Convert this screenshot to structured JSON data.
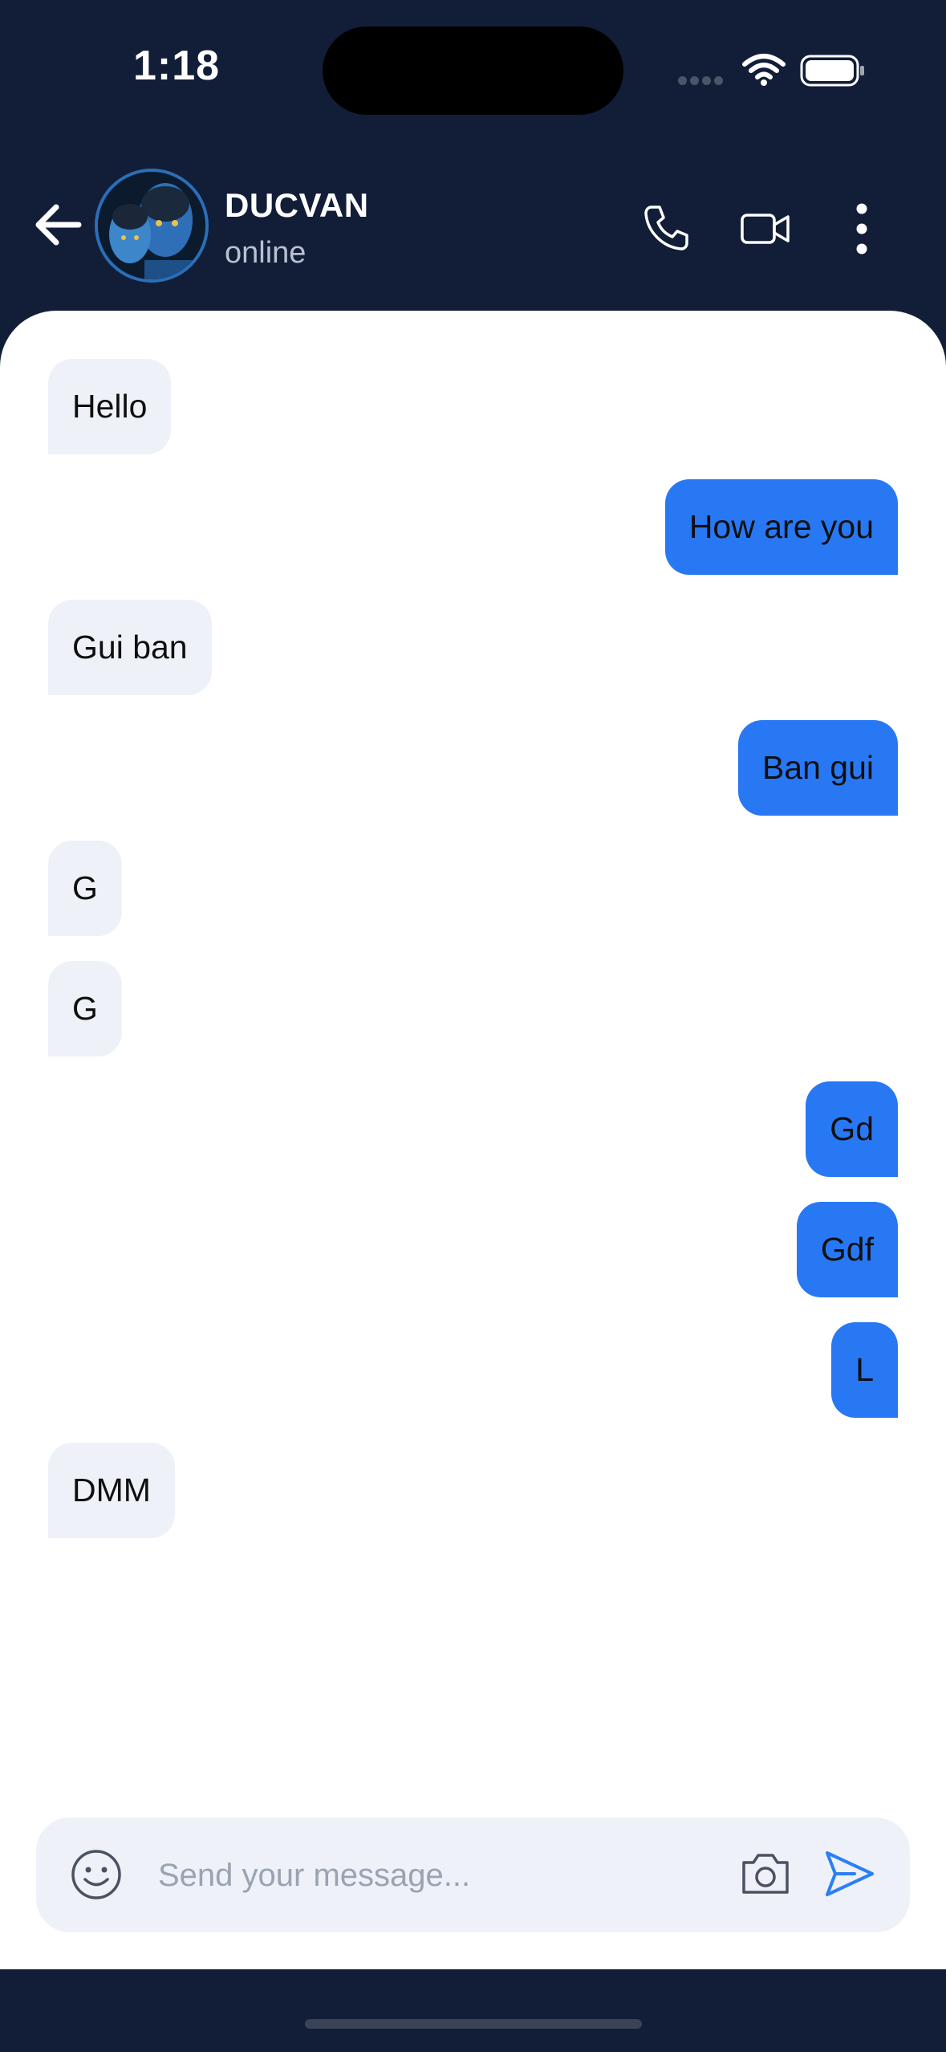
{
  "status_bar": {
    "time": "1:18"
  },
  "header": {
    "contact_name": "DUCVAN",
    "contact_status": "online"
  },
  "messages": [
    {
      "direction": "received",
      "text": "Hello"
    },
    {
      "direction": "sent",
      "text": "How are you"
    },
    {
      "direction": "received",
      "text": "Gui ban"
    },
    {
      "direction": "sent",
      "text": "Ban gui"
    },
    {
      "direction": "received",
      "text": "G"
    },
    {
      "direction": "received",
      "text": "G"
    },
    {
      "direction": "sent",
      "text": "Gd"
    },
    {
      "direction": "sent",
      "text": "Gdf"
    },
    {
      "direction": "sent",
      "text": "L"
    },
    {
      "direction": "received",
      "text": "DMM"
    }
  ],
  "composer": {
    "placeholder": "Send your message...",
    "value": ""
  },
  "icons": {
    "back": "arrow-left-icon",
    "call": "phone-icon",
    "video": "video-camera-icon",
    "more": "more-vertical-icon",
    "emoji": "smiley-icon",
    "camera": "camera-icon",
    "send": "send-icon"
  },
  "colors": {
    "header_bg": "#121e38",
    "sent_bubble": "#2878f4",
    "received_bubble": "#eef2f8",
    "send_accent": "#2b7ff7"
  }
}
